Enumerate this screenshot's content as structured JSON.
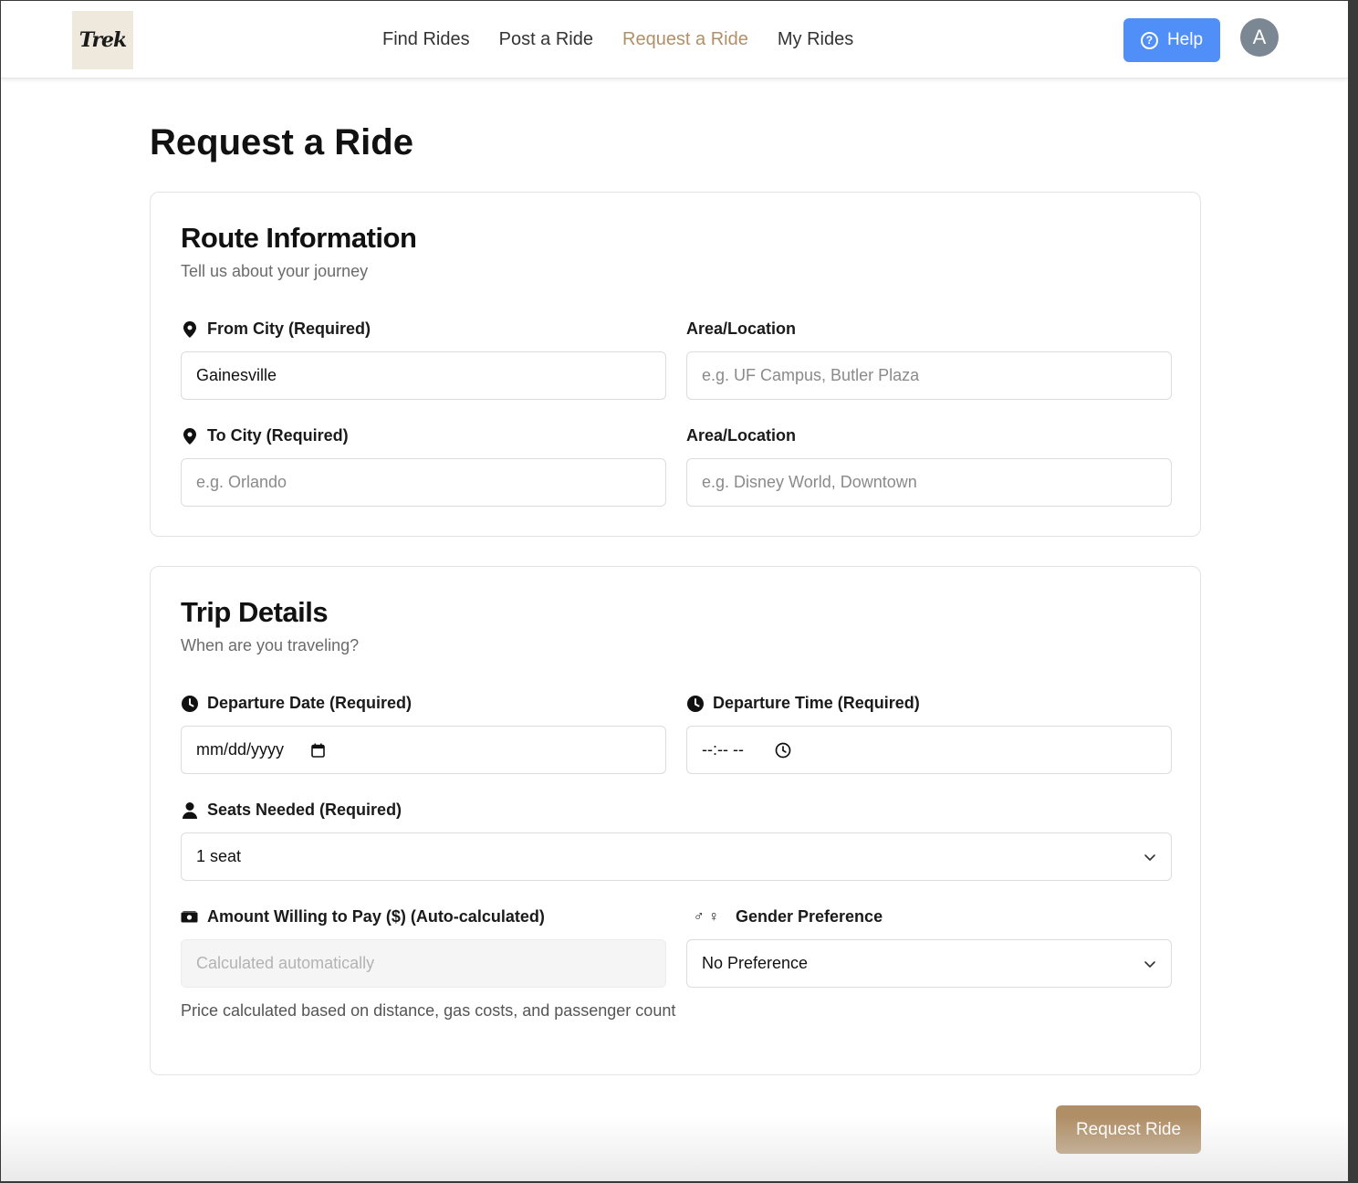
{
  "app": {
    "logo_text": "Trek"
  },
  "nav": {
    "items": [
      {
        "label": "Find Rides",
        "active": false
      },
      {
        "label": "Post a Ride",
        "active": false
      },
      {
        "label": "Request a Ride",
        "active": true
      },
      {
        "label": "My Rides",
        "active": false
      }
    ],
    "help_label": "Help",
    "avatar_initial": "A"
  },
  "page": {
    "title": "Request a Ride"
  },
  "route": {
    "title": "Route Information",
    "subtitle": "Tell us about your journey",
    "from_city": {
      "label": "From City (Required)",
      "value": "Gainesville",
      "placeholder": ""
    },
    "from_area": {
      "label": "Area/Location",
      "placeholder": "e.g. UF Campus, Butler Plaza"
    },
    "to_city": {
      "label": "To City (Required)",
      "placeholder": "e.g. Orlando"
    },
    "to_area": {
      "label": "Area/Location",
      "placeholder": "e.g. Disney World, Downtown"
    }
  },
  "trip": {
    "title": "Trip Details",
    "subtitle": "When are you traveling?",
    "date": {
      "label": "Departure Date (Required)",
      "placeholder": "mm/dd/yyyy"
    },
    "time": {
      "label": "Departure Time (Required)",
      "placeholder": "--:-- --"
    },
    "seats": {
      "label": "Seats Needed (Required)",
      "value": "1 seat"
    },
    "amount": {
      "label": "Amount Willing to Pay ($) (Auto-calculated)",
      "placeholder": "Calculated automatically",
      "helper": "Price calculated based on distance, gas costs, and passenger count"
    },
    "gender": {
      "label": "Gender Preference",
      "value": "No Preference"
    }
  },
  "submit_label": "Request Ride",
  "colors": {
    "accent": "#b08f67",
    "active_nav": "#b09068",
    "help_blue": "#4f8ff7",
    "avatar": "#7b8792",
    "logo_bg": "#efe9dd"
  },
  "icons": [
    "map-pin-icon",
    "clock-icon",
    "calendar-icon",
    "person-icon",
    "cash-icon",
    "gender-icon",
    "chevron-down-icon",
    "help-circle-icon"
  ]
}
